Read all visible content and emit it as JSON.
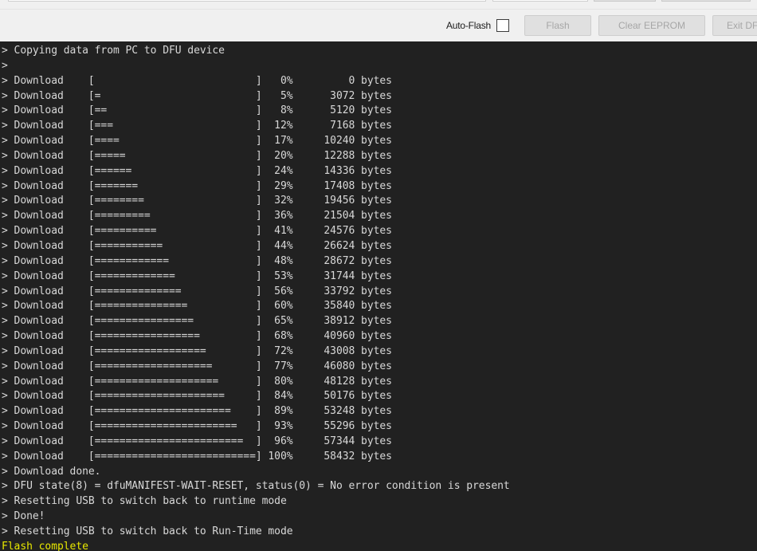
{
  "window": {
    "background_color": "#f0f0f0"
  },
  "toolbar": {
    "auto_flash_label": "Auto-Flash",
    "auto_flash_checked": false,
    "buttons": [
      {
        "label": "Flash",
        "enabled": false,
        "name": "flash-button"
      },
      {
        "label": "Clear EEPROM",
        "enabled": false,
        "name": "clear-eeprom-button"
      },
      {
        "label": "Exit DFU",
        "enabled": false,
        "name": "exit-dfu-button"
      }
    ]
  },
  "console": {
    "background_color": "#212121",
    "text_color": "#d8d8d8",
    "accent_color": "#e8e800",
    "lines": [
      {
        "text": "> Copying data from PC to DFU device",
        "accent": false
      },
      {
        "text": ">",
        "accent": false
      },
      {
        "text": "> Download    [                          ]   0%         0 bytes",
        "accent": false
      },
      {
        "text": "> Download    [=                         ]   5%      3072 bytes",
        "accent": false
      },
      {
        "text": "> Download    [==                        ]   8%      5120 bytes",
        "accent": false
      },
      {
        "text": "> Download    [===                       ]  12%      7168 bytes",
        "accent": false
      },
      {
        "text": "> Download    [====                      ]  17%     10240 bytes",
        "accent": false
      },
      {
        "text": "> Download    [=====                     ]  20%     12288 bytes",
        "accent": false
      },
      {
        "text": "> Download    [======                    ]  24%     14336 bytes",
        "accent": false
      },
      {
        "text": "> Download    [=======                   ]  29%     17408 bytes",
        "accent": false
      },
      {
        "text": "> Download    [========                  ]  32%     19456 bytes",
        "accent": false
      },
      {
        "text": "> Download    [=========                 ]  36%     21504 bytes",
        "accent": false
      },
      {
        "text": "> Download    [==========                ]  41%     24576 bytes",
        "accent": false
      },
      {
        "text": "> Download    [===========               ]  44%     26624 bytes",
        "accent": false
      },
      {
        "text": "> Download    [============              ]  48%     28672 bytes",
        "accent": false
      },
      {
        "text": "> Download    [=============             ]  53%     31744 bytes",
        "accent": false
      },
      {
        "text": "> Download    [==============            ]  56%     33792 bytes",
        "accent": false
      },
      {
        "text": "> Download    [===============           ]  60%     35840 bytes",
        "accent": false
      },
      {
        "text": "> Download    [================          ]  65%     38912 bytes",
        "accent": false
      },
      {
        "text": "> Download    [=================         ]  68%     40960 bytes",
        "accent": false
      },
      {
        "text": "> Download    [==================        ]  72%     43008 bytes",
        "accent": false
      },
      {
        "text": "> Download    [===================       ]  77%     46080 bytes",
        "accent": false
      },
      {
        "text": "> Download    [====================      ]  80%     48128 bytes",
        "accent": false
      },
      {
        "text": "> Download    [=====================     ]  84%     50176 bytes",
        "accent": false
      },
      {
        "text": "> Download    [======================    ]  89%     53248 bytes",
        "accent": false
      },
      {
        "text": "> Download    [=======================   ]  93%     55296 bytes",
        "accent": false
      },
      {
        "text": "> Download    [========================  ]  96%     57344 bytes",
        "accent": false
      },
      {
        "text": "> Download    [==========================] 100%     58432 bytes",
        "accent": false
      },
      {
        "text": "> Download done.",
        "accent": false
      },
      {
        "text": "> DFU state(8) = dfuMANIFEST-WAIT-RESET, status(0) = No error condition is present",
        "accent": false
      },
      {
        "text": "> Resetting USB to switch back to runtime mode",
        "accent": false
      },
      {
        "text": "> Done!",
        "accent": false
      },
      {
        "text": "> Resetting USB to switch back to Run-Time mode",
        "accent": false
      },
      {
        "text": "Flash complete",
        "accent": true
      }
    ]
  }
}
